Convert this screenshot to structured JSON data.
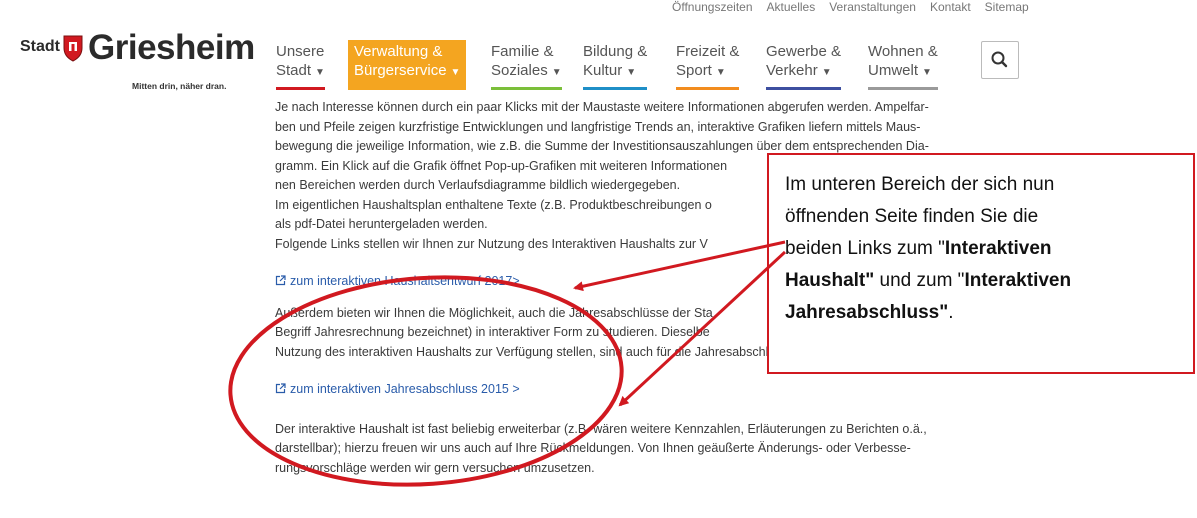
{
  "util_nav": [
    "Öffnungszeiten",
    "Aktuelles",
    "Veranstaltungen",
    "Kontakt",
    "Sitemap"
  ],
  "logo": {
    "stadt": "Stadt",
    "name": "Griesheim",
    "tagline": "Mitten drin, näher dran."
  },
  "nav": [
    {
      "line1": "Unsere",
      "line2": "Stadt",
      "bar_color": "#d11920",
      "active": false
    },
    {
      "line1": "Verwaltung &",
      "line2": "Bürgerservice",
      "bar_color": "#f4a520",
      "active": true
    },
    {
      "line1": "Familie &",
      "line2": "Soziales",
      "bar_color": "#7bbf3a",
      "active": false
    },
    {
      "line1": "Bildung &",
      "line2": "Kultur",
      "bar_color": "#1f8fc7",
      "active": false
    },
    {
      "line1": "Freizeit &",
      "line2": "Sport",
      "bar_color": "#f28c1e",
      "active": false
    },
    {
      "line1": "Gewerbe &",
      "line2": "Verkehr",
      "bar_color": "#3d4fa0",
      "active": false
    },
    {
      "line1": "Wohnen &",
      "line2": "Umwelt",
      "bar_color": "#9a9a9a",
      "active": false
    }
  ],
  "search_icon": "search-icon",
  "content": {
    "para1": [
      "Je nach Interesse können durch ein paar Klicks mit der Maustaste weitere Informationen abgerufen werden. Ampelfar-",
      "ben und Pfeile zeigen kurzfristige Entwicklungen und langfristige Trends an, interaktive Grafiken liefern mittels Maus-",
      "bewegung die jeweilige Information, wie z.B. die Summe der Investitionsauszahlungen über dem entsprechenden Dia-",
      "gramm. Ein Klick auf die Grafik öffnet Pop-up-Grafiken mit weiteren Informationen",
      "nen Bereichen werden durch Verlaufsdiagramme bildlich wiedergegeben.",
      "Im eigentlichen Haushaltsplan enthaltene Texte (z.B. Produktbeschreibungen o",
      "als pdf-Datei heruntergeladen werden.",
      "Folgende Links stellen wir Ihnen zur Nutzung des Interaktiven Haushalts zur V"
    ],
    "link1": "zum interaktiven Haushaltsentwurf 2017>",
    "para2": [
      "Außerdem bieten wir Ihnen die Möglichkeit, auch die Jahresabschlüsse der Sta",
      "Begriff Jahresrechnung bezeichnet) in interaktiver Form zu studieren. Dieselbe",
      "Nutzung des interaktiven Haushalts zur Verfügung stellen, sind auch für die Jahresabschlüsse nutzbar."
    ],
    "link2": "zum interaktiven Jahresabschluss 2015 >",
    "para3": [
      "Der interaktive Haushalt ist fast beliebig erweiterbar (z.B. wären weitere Kennzahlen, Erläuterungen zu Berichten o.ä.,",
      "darstellbar); hierzu freuen wir uns auch auf Ihre Rückmeldungen. Von Ihnen geäußerte Änderungs- oder Verbesse-",
      "rungsvorschläge werden wir gern versuchen umzusetzen."
    ]
  },
  "callout": {
    "line1": "Im unteren Bereich der sich nun",
    "line2": "öffnenden Seite finden Sie die",
    "line3_pre": "beiden Links zum \"",
    "line3_bold": "Interaktiven",
    "line4_bold": "Haushalt\"",
    "line4_mid": " und zum \"",
    "line4_bold2": "Interaktiven",
    "line5_bold": "Jahresabschluss\"",
    "line5_post": "."
  },
  "colors": {
    "annotation_red": "#d11920",
    "link_blue": "#2a5caa",
    "active_nav": "#f4a520"
  }
}
